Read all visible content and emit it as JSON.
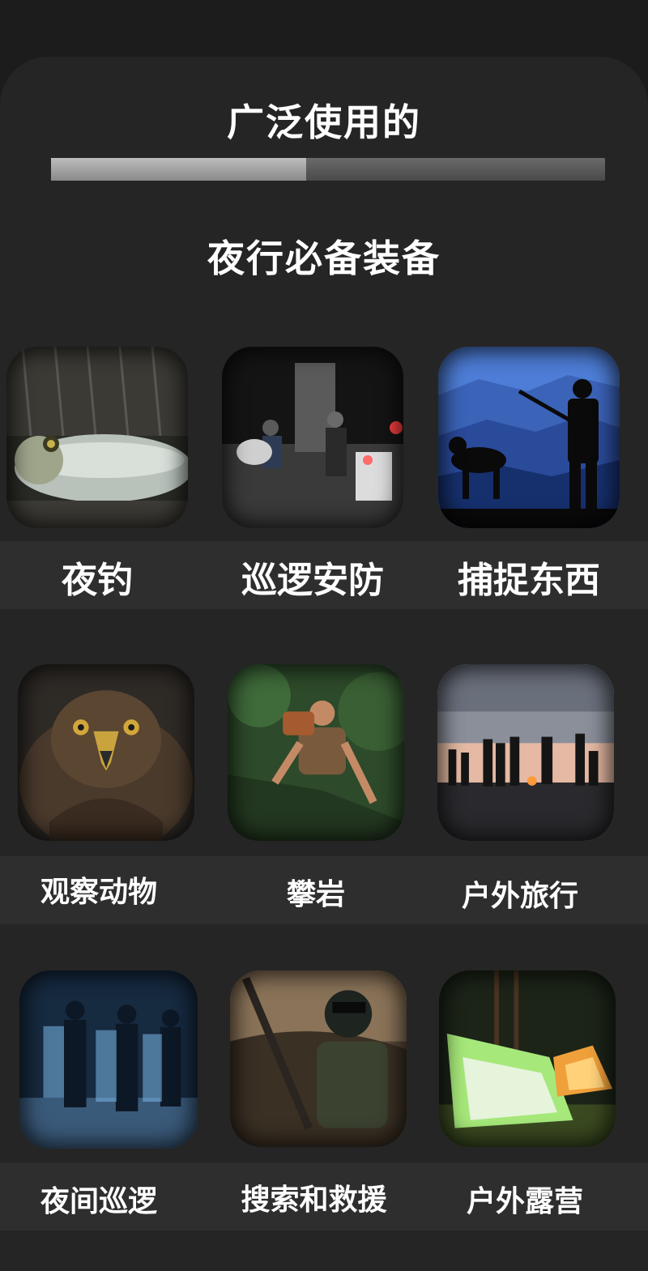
{
  "header": {
    "title": "广泛使用的",
    "progress": 0.46,
    "subtitle": "夜行必备装备"
  },
  "grid": {
    "items": [
      {
        "label": "夜钓",
        "icon": "fish-photo"
      },
      {
        "label": "巡逻安防",
        "icon": "patrol-photo"
      },
      {
        "label": "捕捉东西",
        "icon": "hunter-photo"
      },
      {
        "label": "观察动物",
        "icon": "eagle-photo"
      },
      {
        "label": "攀岩",
        "icon": "climber-photo"
      },
      {
        "label": "户外旅行",
        "icon": "campfire-photo"
      },
      {
        "label": "夜间巡逻",
        "icon": "police-photo"
      },
      {
        "label": "搜索和救援",
        "icon": "pilot-photo"
      },
      {
        "label": "户外露营",
        "icon": "tent-photo"
      }
    ]
  }
}
